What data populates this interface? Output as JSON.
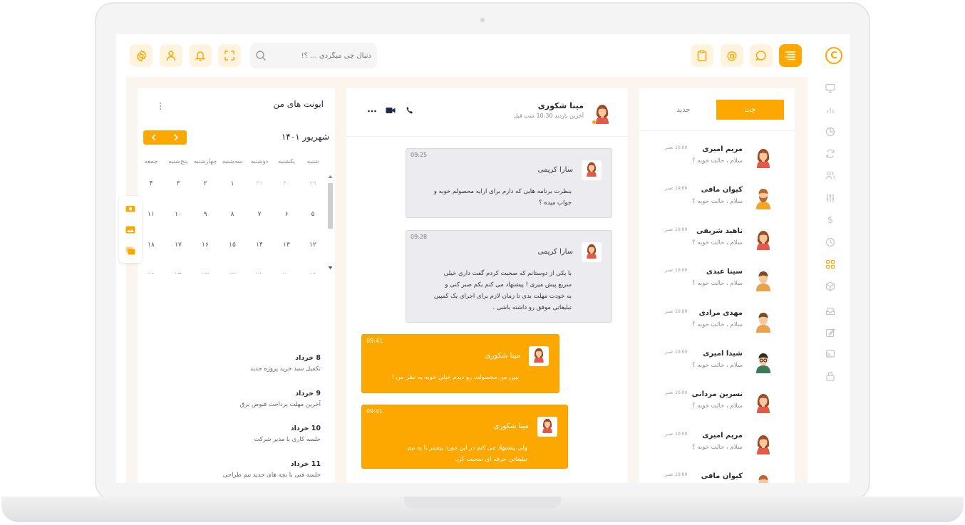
{
  "search": {
    "placeholder": "دنبال چی میگردی ... ؟!"
  },
  "chat_list": {
    "tabs": [
      {
        "label": "چت",
        "active": true
      },
      {
        "label": "جدید",
        "active": false
      }
    ],
    "items": [
      {
        "name": "مریم امیری",
        "preview": "سلام ، حالت خوبه ؟",
        "time": "10:00 عصر",
        "avatar": "female-avatar"
      },
      {
        "name": "کیوان مافی",
        "preview": "سلام ، حالت خوبه ؟",
        "time": "10:00 عصر",
        "avatar": "male-beard-avatar"
      },
      {
        "name": "ناهید شریفی",
        "preview": "سلام ، حالت خوبه ؟",
        "time": "10:00 عصر",
        "avatar": "female-avatar"
      },
      {
        "name": "سینا عبدی",
        "preview": "سلام ، حالت خوبه ؟",
        "time": "10:00 عصر",
        "avatar": "male-avatar"
      },
      {
        "name": "مهدی مرادی",
        "preview": "سلام ، حالت خوبه ؟",
        "time": "10:00 عصر",
        "avatar": "male-avatar"
      },
      {
        "name": "شیدا امیری",
        "preview": "سلام ، حالت خوبه ؟",
        "time": "10:00 عصر",
        "avatar": "male-glasses-avatar"
      },
      {
        "name": "نسرین مردانی",
        "preview": "سلام ، حالت خوبه ؟",
        "time": "10:00 عصر",
        "avatar": "female-avatar"
      },
      {
        "name": "مریم امیری",
        "preview": "سلام ، حالت خوبه ؟",
        "time": "10:00 عصر",
        "avatar": "female-avatar"
      },
      {
        "name": "کیوان مافی",
        "preview": "",
        "time": "10:00 عصر",
        "avatar": "male-beard-avatar"
      }
    ]
  },
  "conversation": {
    "contact_name": "مینا شکوری",
    "last_seen": "آخرین بازدید 10:30 شب قبل",
    "messages": [
      {
        "sender": "سارا کریمی",
        "time": "09:25",
        "lines": [
          "بنظرت برنامه هایی که دارم برای ارایه محصولم خوبه و",
          "جواب میده ؟"
        ],
        "side": "incoming"
      },
      {
        "sender": "سارا کریمی",
        "time": "09:28",
        "lines": [
          "با یکی از دوستانم که صحبت کردم گفت داری خیلی",
          "سریع پیش میری ! پیشنهاد می کنم یکم صبر کنی و",
          "به خودت مهلت بدی تا زمان لازم برای اجرای یک کمپین",
          "تبلیغاتی موفق رو داشته باشی ."
        ],
        "side": "incoming"
      },
      {
        "sender": "مینا شکوری",
        "time": "09:41",
        "lines": [
          "ببین من محصولت رو دیدم خیلی خوبه به نظر من !"
        ],
        "side": "outgoing"
      },
      {
        "sender": "مینا شکوری",
        "time": "09:41",
        "lines": [
          "ولی پیشنهاد می کنم در این مورد بیشتر با یه تیم",
          "تبلیغاتی حرفه ای صحبت کن."
        ],
        "side": "outgoing"
      }
    ]
  },
  "calendar": {
    "title": "ایونت های من",
    "month": "شهریور ۱۴۰۱",
    "weekdays": [
      "شنبه",
      "یکشنبه",
      "دوشنبه",
      "سه‌شنبه",
      "چهارشنبه",
      "پنج‌شنبه",
      "جمعه"
    ],
    "rows": [
      [
        "۲۹",
        "۳۰",
        "۳۱",
        "۱",
        "۲",
        "۳",
        "۴"
      ],
      [
        "۵",
        "۶",
        "۷",
        "۸",
        "۹",
        "۱۰",
        "۱۱"
      ],
      [
        "۱۲",
        "۱۳",
        "۱۴",
        "۱۵",
        "۱۶",
        "۱۷",
        "۱۸"
      ],
      [
        "۱۹",
        "۲۰",
        "۲۱",
        "۲۲",
        "۲۳",
        "۲۴",
        "۲۵"
      ]
    ],
    "muted_first_row": 3
  },
  "events": [
    {
      "date": "8 خرداد",
      "desc": "تکمیل سبد خرید پروژه جدید"
    },
    {
      "date": "9 خرداد",
      "desc": "آخرین مهلت پرداخت قبوض برق"
    },
    {
      "date": "10 خرداد",
      "desc": "جلسه کاری با مدیر شرکت"
    },
    {
      "date": "11 خرداد",
      "desc": "جلسه فنی با بچه های جدید تیم طراحی"
    }
  ],
  "colors": {
    "accent": "#fda800",
    "accent_light": "#fef3df",
    "bubble_incoming": "#ececf0",
    "text_dark": "#2a2a2a",
    "text_muted": "#8d8d8d"
  }
}
